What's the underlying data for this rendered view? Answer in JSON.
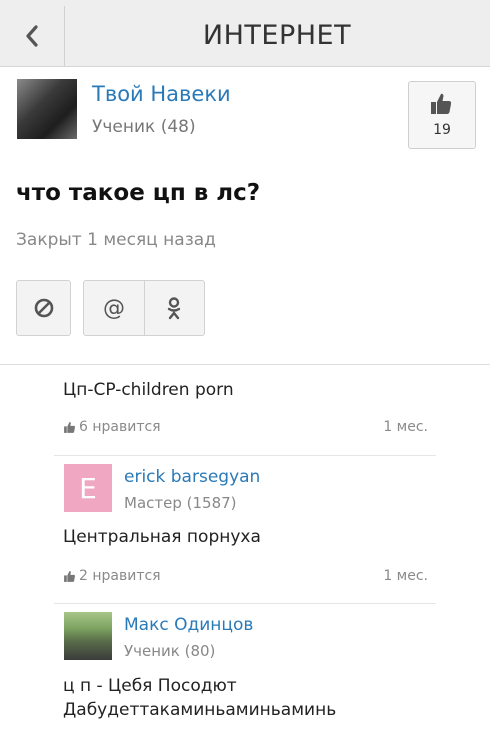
{
  "header": {
    "title": "ИНТЕРНЕТ"
  },
  "author": {
    "name": "Твой Навеки",
    "rank": "Ученик (48)",
    "likes": "19"
  },
  "question": {
    "text": "что такое цп в лс?",
    "status": "Закрыт 1 месяц назад"
  },
  "actions": [
    {
      "icon": "block-icon"
    },
    {
      "icon": "mail-icon"
    },
    {
      "icon": "odnoklassniki-icon"
    }
  ],
  "answers": [
    {
      "text": "Цп-CP-children porn",
      "likes": "6 нравится",
      "time": "1 мес."
    },
    {
      "author": "erick barsegyan",
      "avatar_letter": "E",
      "rank": "Мастер (1587)",
      "text": "Центральная порнуха",
      "likes": "2 нравится",
      "time": "1 мес."
    },
    {
      "author": "Макс Одинцов",
      "rank": "Ученик (80)",
      "text_line1": "ц п - Цебя Посодют",
      "text_line2": "Дабудеттакаминьаминьаминь"
    }
  ],
  "colors": {
    "link": "#2a7ab8",
    "avatar_pink": "#f0a8c2"
  }
}
